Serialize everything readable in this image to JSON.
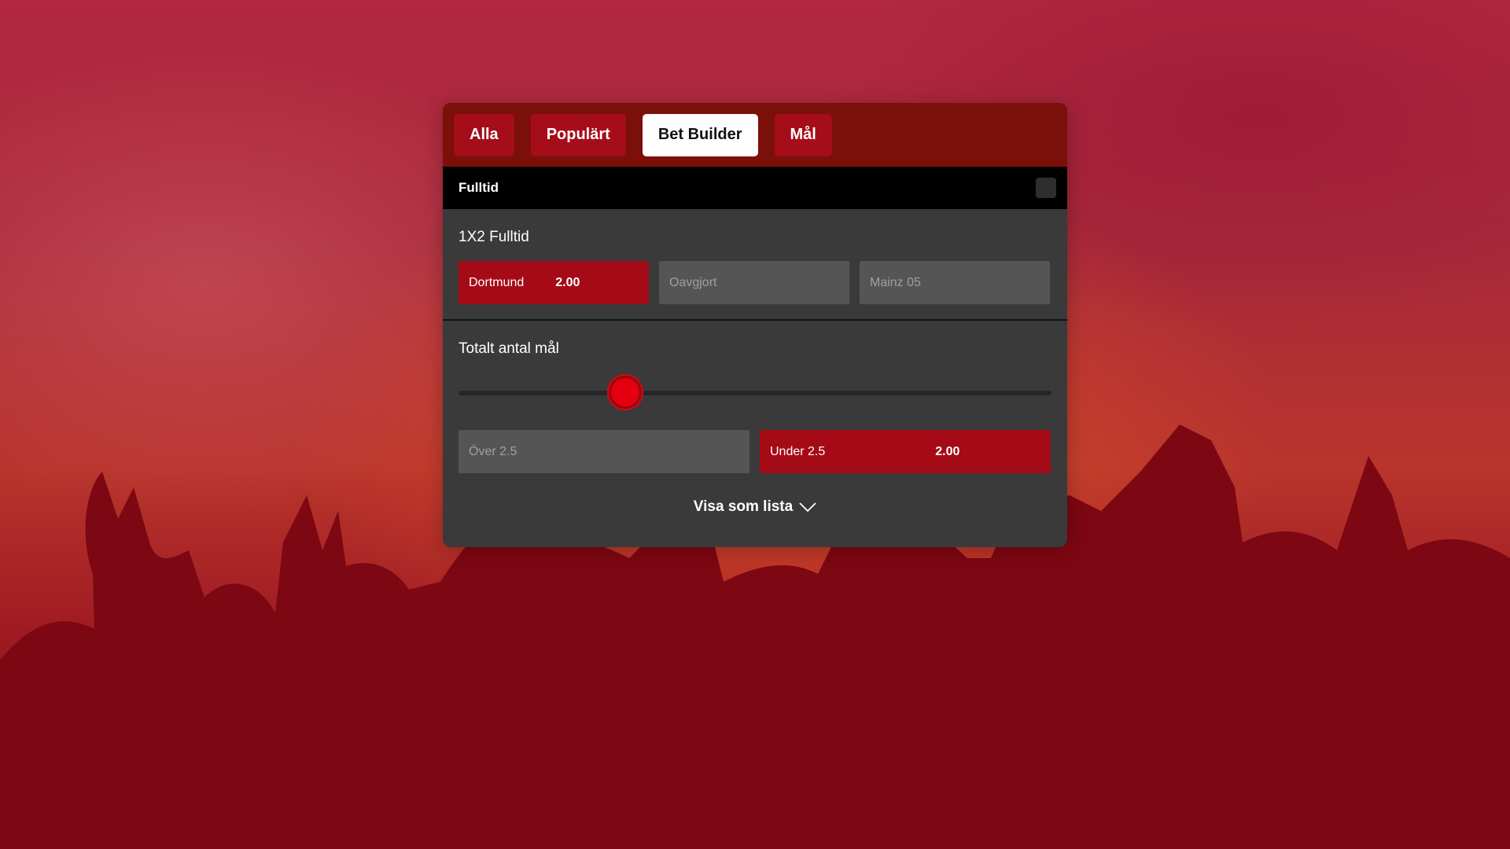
{
  "tabs": [
    {
      "label": "Alla",
      "active": false
    },
    {
      "label": "Populärt",
      "active": false
    },
    {
      "label": "Bet Builder",
      "active": true
    },
    {
      "label": "Mål",
      "active": false
    }
  ],
  "section": {
    "title": "Fulltid"
  },
  "market_1x2": {
    "title": "1X2 Fulltid",
    "home": {
      "label": "Dortmund",
      "price": "2.00",
      "selected": true
    },
    "draw": {
      "label": "Oavgjort",
      "selected": false
    },
    "away": {
      "label": "Mainz 05",
      "selected": false
    }
  },
  "market_goals": {
    "title": "Totalt antal mål",
    "slider_fraction": 0.28,
    "over": {
      "label": "Över 2.5",
      "selected": false
    },
    "under": {
      "label": "Under 2.5",
      "price": "2.00",
      "selected": true
    }
  },
  "footer": {
    "show_as_list_label": "Visa som lista",
    "icon": "chevron-down-icon"
  },
  "colors": {
    "accent": "#a50b16",
    "tabbar": "#7b0f0a",
    "panel": "#3a3a3a",
    "slider_thumb": "#e4000f"
  }
}
